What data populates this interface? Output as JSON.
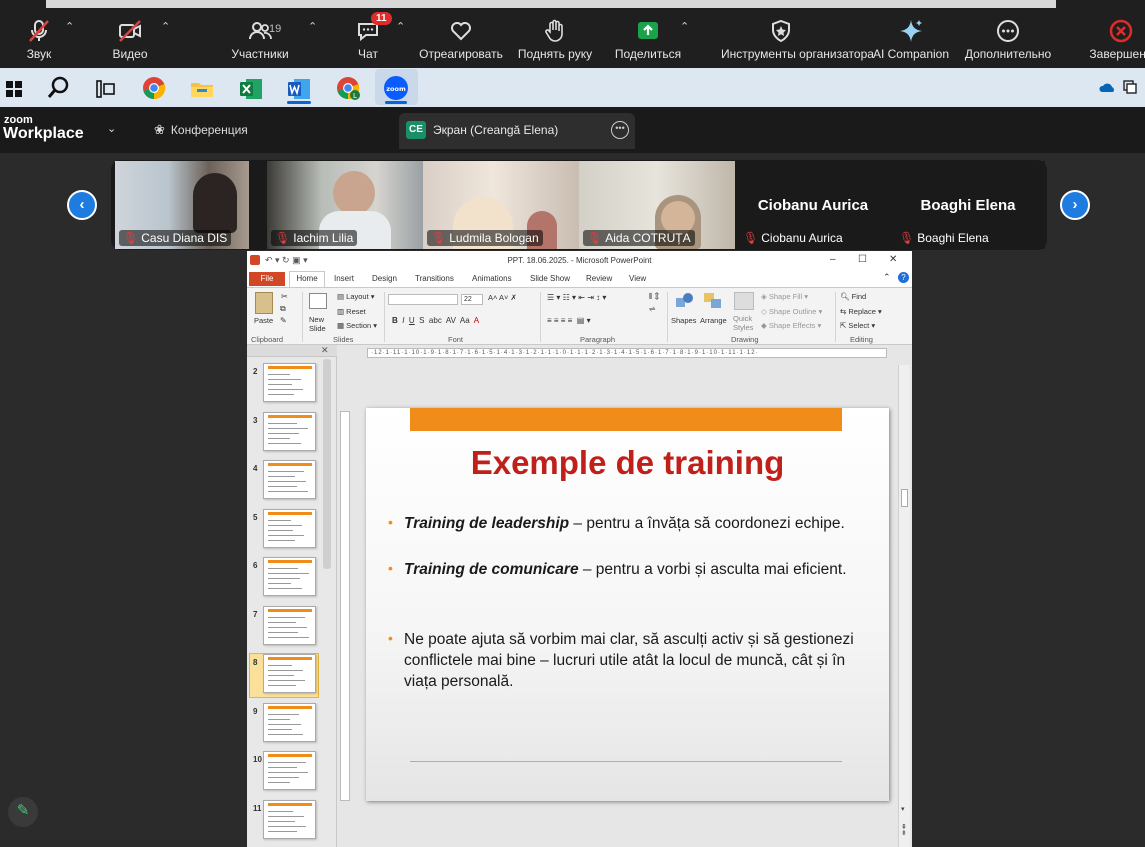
{
  "zoom_toolbar": {
    "buttons": [
      {
        "label": "Звук",
        "icon": "mic-muted-icon"
      },
      {
        "label": "Видео",
        "icon": "camera-off-icon"
      },
      {
        "label": "Участники",
        "icon": "participants-icon",
        "count": "19"
      },
      {
        "label": "Чат",
        "icon": "chat-icon",
        "badge": "11"
      },
      {
        "label": "Отреагировать",
        "icon": "heart-icon"
      },
      {
        "label": "Поднять руку",
        "icon": "raise-hand-icon"
      },
      {
        "label": "Поделиться",
        "icon": "share-screen-icon"
      },
      {
        "label": "Инструменты организатора",
        "icon": "shield-icon"
      },
      {
        "label": "AI Companion",
        "icon": "sparkle-icon"
      },
      {
        "label": "Дополнительно",
        "icon": "more-icon"
      },
      {
        "label": "Завершени",
        "icon": "end-icon"
      }
    ],
    "colors": {
      "share_green": "#1aa34a",
      "muted_red": "#e04040",
      "end_red": "#e02b2b"
    }
  },
  "taskbar": {
    "icons": [
      "windows-start-icon",
      "search-icon",
      "task-view-icon",
      "chrome-icon",
      "file-explorer-icon",
      "excel-icon",
      "word-icon",
      "chrome-profile-icon",
      "zoom-icon"
    ]
  },
  "zoom_header": {
    "logo_top": "zoom",
    "logo_bottom": "Workplace",
    "conference_tab": "Конференция",
    "screen_badge": "CE",
    "screen_tab": "Экран (Creangă Elena)"
  },
  "video_strip": {
    "participants": [
      {
        "name": "Casu Diana DIS"
      },
      {
        "name": "Iachim Lilia"
      },
      {
        "name": "Ludmila Bologan"
      },
      {
        "name": "Aida COTRUȚA"
      },
      {
        "name": "Ciobanu Aurica",
        "big_name": "Ciobanu Aurica"
      },
      {
        "name": "Boaghi Elena",
        "big_name": "Boaghi Elena"
      }
    ]
  },
  "ppt": {
    "window_title": "PPT. 18.06.2025. - Microsoft PowerPoint",
    "tabs": [
      "File",
      "Home",
      "Insert",
      "Design",
      "Transitions",
      "Animations",
      "Slide Show",
      "Review",
      "View"
    ],
    "ribbon": {
      "clipboard": {
        "paste": "Paste",
        "group": "Clipboard"
      },
      "slides": {
        "new_slide": "New Slide",
        "layout": "Layout",
        "reset": "Reset",
        "section": "Section",
        "group": "Slides"
      },
      "font": {
        "size": "22",
        "group": "Font"
      },
      "paragraph": {
        "group": "Paragraph"
      },
      "drawing": {
        "shapes": "Shapes",
        "arrange": "Arrange",
        "quick_styles": "Quick Styles",
        "shape_fill": "Shape Fill",
        "shape_outline": "Shape Outline",
        "shape_effects": "Shape Effects",
        "group": "Drawing"
      },
      "editing": {
        "find": "Find",
        "replace": "Replace",
        "select": "Select",
        "group": "Editing"
      }
    },
    "ruler_text": "·12·1·11·1·10·1·9·1·8·1·7·1·6·1·5·1·4·1·3·1·2·1·1·1·0·1·1·1·2·1·3·1·4·1·5·1·6·1·7·1·8·1·9·1·10·1·11·1·12·",
    "thumbnails": [
      {
        "num": "2"
      },
      {
        "num": "3"
      },
      {
        "num": "4"
      },
      {
        "num": "5"
      },
      {
        "num": "6",
        "selected": true
      },
      {
        "num": "7"
      },
      {
        "num": "8"
      },
      {
        "num": "9"
      },
      {
        "num": "10"
      },
      {
        "num": "11"
      }
    ],
    "slide": {
      "title": "Exemple de training",
      "bullets": [
        {
          "bold": "Training de leadership",
          "rest": " – pentru a învăța să coordonezi echipe."
        },
        {
          "bold": "Training de comunicare",
          "rest": " – pentru a vorbi și asculta mai eficient."
        },
        {
          "bold": "",
          "rest": "Ne poate ajuta să vorbim mai clar, să asculți activ și să gestionezi conflictele mai bine – lucruri utile atât la locul de muncă, cât și în viața personală."
        }
      ],
      "colors": {
        "accent_orange": "#f08c1a",
        "title_red": "#c0201a"
      }
    }
  }
}
